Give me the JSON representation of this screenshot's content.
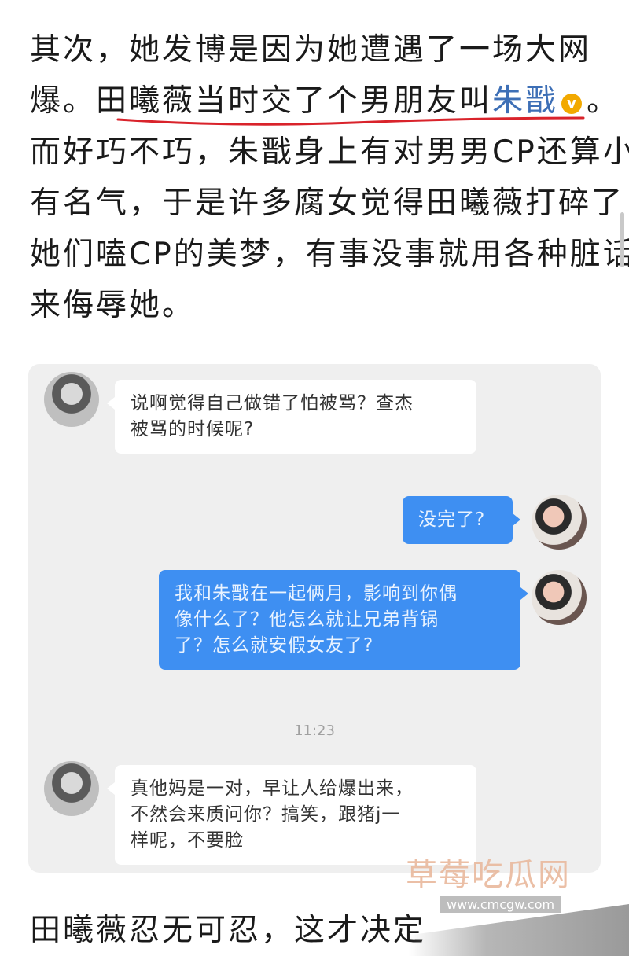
{
  "paragraph1": {
    "line1": "其次，她发博是因为她遭遇了一场大网",
    "line2_pre": "爆。田曦薇当时交了个男朋友叫",
    "line2_link": "朱戬",
    "line2_badge": "v",
    "line2_post": "。",
    "line3": "而好巧不巧，朱戬身上有对男男CP还算小",
    "line4": "有名气，于是许多腐女觉得田曦薇打碎了",
    "line5": "她们嗑CP的美梦，有事没事就用各种脏话",
    "line6": "来侮辱她。"
  },
  "chat": {
    "msg1_line1": "说啊觉得自己做错了怕被骂？查杰",
    "msg1_line2": "被骂的时候呢?",
    "msg2": "没完了?",
    "msg3_line1": "我和朱戬在一起俩月，影响到你偶",
    "msg3_line2": "像什么了？他怎么就让兄弟背锅",
    "msg3_line3": "了？怎么就安假女友了?",
    "time": "11:23",
    "msg4_line1": "真他妈是一对，早让人给爆出来，",
    "msg4_line2": "不然会来质问你？搞笑，跟猪j一",
    "msg4_line3": "样呢，不要脸"
  },
  "paragraph2": {
    "line1": "田曦薇忍无可忍，这才决定"
  },
  "watermark": {
    "title": "草莓吃瓜网",
    "url": "www.cmcgw.com"
  },
  "colors": {
    "link": "#3d6fb6",
    "underline": "#d9232b",
    "out_bubble": "#3e8ff2",
    "verified_badge": "#f2a900"
  }
}
